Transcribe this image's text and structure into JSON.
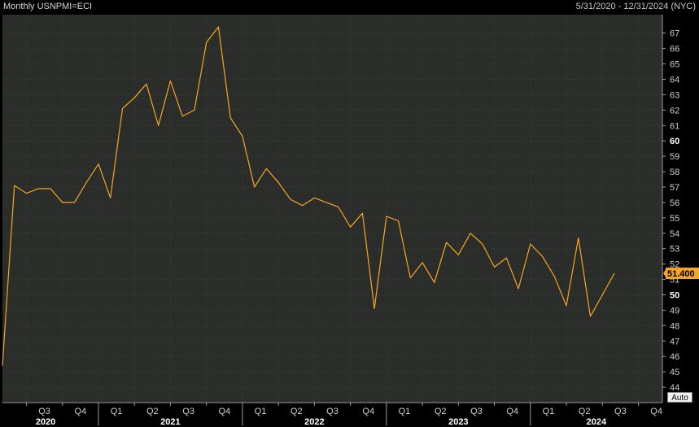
{
  "header": {
    "title": "Monthly USNPMI=ECI",
    "range": "5/31/2020 - 12/31/2024 (NYC)"
  },
  "auto_label": "Auto",
  "colors": {
    "background": "#000000",
    "plot_background": "#2a2d2a",
    "line": "#f5a623",
    "grid": "#3c3f3c",
    "last_value_bg": "#f5a623"
  },
  "chart_data": {
    "type": "line",
    "title": "Monthly USNPMI=ECI",
    "x_start": "2020-05",
    "x_end": "2024-12",
    "ylim": [
      43,
      68.2
    ],
    "y_ticks": [
      44,
      45,
      46,
      47,
      48,
      49,
      50,
      51,
      52,
      53,
      54,
      55,
      56,
      57,
      58,
      59,
      60,
      61,
      62,
      63,
      64,
      65,
      66,
      67
    ],
    "y_tick_labels": [
      "44",
      "45",
      "46",
      "47",
      "48",
      "49",
      "50",
      "51",
      "52",
      "53",
      "54",
      "55",
      "56",
      "57",
      "58",
      "59",
      "60",
      "61",
      "62",
      "63",
      "64",
      "65",
      "66",
      "67"
    ],
    "bold_ticks": [
      50,
      60
    ],
    "grid": true,
    "quarter_labels": [
      "Q3",
      "Q4",
      "Q1",
      "Q2",
      "Q3",
      "Q4",
      "Q1",
      "Q2",
      "Q3",
      "Q4",
      "Q1",
      "Q2",
      "Q3",
      "Q4",
      "Q1",
      "Q2",
      "Q3",
      "Q4"
    ],
    "year_labels": [
      "2020",
      "2021",
      "2022",
      "2023",
      "2024"
    ],
    "last_value_label": "51.400",
    "series": [
      {
        "x": [
          "2020-05",
          "2020-06",
          "2020-07",
          "2020-08",
          "2020-09",
          "2020-10",
          "2020-11",
          "2020-12",
          "2021-01",
          "2021-02",
          "2021-03",
          "2021-04",
          "2021-05",
          "2021-06",
          "2021-07",
          "2021-08",
          "2021-09",
          "2021-10",
          "2021-11",
          "2021-12",
          "2022-01",
          "2022-02",
          "2022-03",
          "2022-04",
          "2022-05",
          "2022-06",
          "2022-07",
          "2022-08",
          "2022-09",
          "2022-10",
          "2022-11",
          "2022-12",
          "2023-01",
          "2023-02",
          "2023-03",
          "2023-04",
          "2023-05",
          "2023-06",
          "2023-07",
          "2023-08",
          "2023-09",
          "2023-10",
          "2023-11",
          "2023-12",
          "2024-01",
          "2024-02",
          "2024-03",
          "2024-04",
          "2024-05",
          "2024-06",
          "2024-07",
          "2024-08"
        ],
        "values": [
          45.4,
          57.1,
          56.6,
          56.9,
          56.9,
          56.0,
          56.0,
          57.3,
          58.5,
          56.3,
          62.1,
          62.8,
          63.7,
          61.0,
          63.9,
          61.6,
          62.0,
          66.4,
          67.4,
          61.5,
          60.3,
          57.0,
          58.2,
          57.3,
          56.2,
          55.8,
          56.3,
          56.0,
          55.7,
          54.4,
          55.3,
          49.1,
          55.1,
          54.8,
          51.1,
          52.1,
          50.8,
          53.4,
          52.6,
          54.0,
          53.3,
          51.8,
          52.4,
          50.4,
          53.3,
          52.5,
          51.2,
          49.3,
          53.7,
          48.6,
          null,
          51.4
        ]
      }
    ]
  }
}
